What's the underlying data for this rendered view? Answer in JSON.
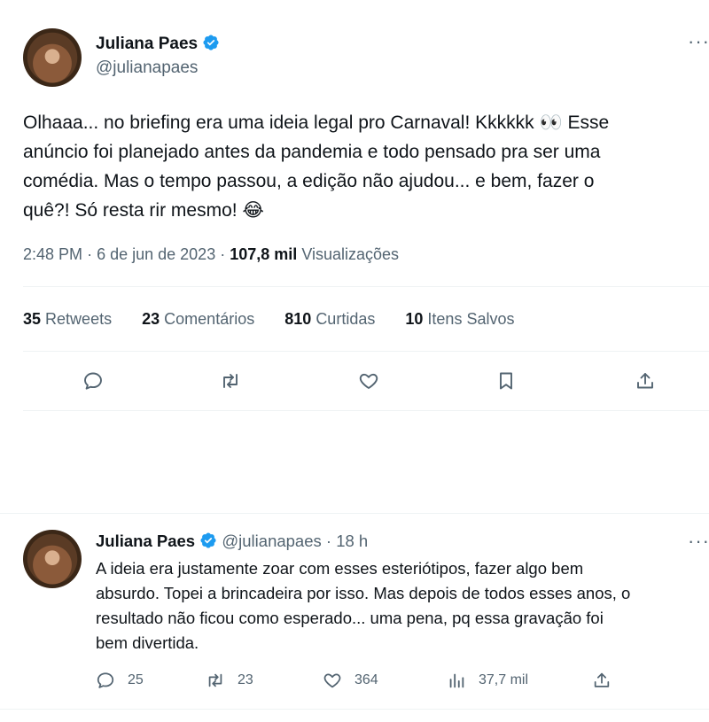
{
  "main_tweet": {
    "author_name": "Juliana Paes",
    "handle": "@julianapaes",
    "text_lines": [
      "Olhaaa... no briefing era uma ideia legal pro Carnaval! Kkkkkk 👀 Esse",
      "anúncio foi planejado antes da pandemia e todo pensado pra ser uma",
      "comédia. Mas o tempo passou, a edição não ajudou... e bem, fazer o",
      "quê?! Só resta rir mesmo! 😂"
    ],
    "time": "2:48 PM",
    "date": "6 de jun de 2023",
    "views_count": "107,8 mil",
    "views_label": "Visualizações",
    "stats": {
      "retweets_count": "35",
      "retweets_label": "Retweets",
      "comments_count": "23",
      "comments_label": "Comentários",
      "likes_count": "810",
      "likes_label": "Curtidas",
      "saved_count": "10",
      "saved_label": "Itens Salvos"
    }
  },
  "reply_tweet": {
    "author_name": "Juliana Paes",
    "handle": "@julianapaes",
    "age": "18 h",
    "text_lines": [
      "A ideia era justamente zoar com esses esteriótipos, fazer algo bem",
      "absurdo. Topei a brincadeira por isso. Mas depois de todos esses anos, o",
      "resultado não ficou como esperado... uma pena, pq essa gravação foi",
      "bem divertida."
    ],
    "replies": "25",
    "retweets": "23",
    "likes": "364",
    "views": "37,7 mil"
  },
  "colors": {
    "verified": "#1d9bf0",
    "muted": "#536471",
    "text": "#0f1419",
    "divider": "#eff3f4"
  }
}
